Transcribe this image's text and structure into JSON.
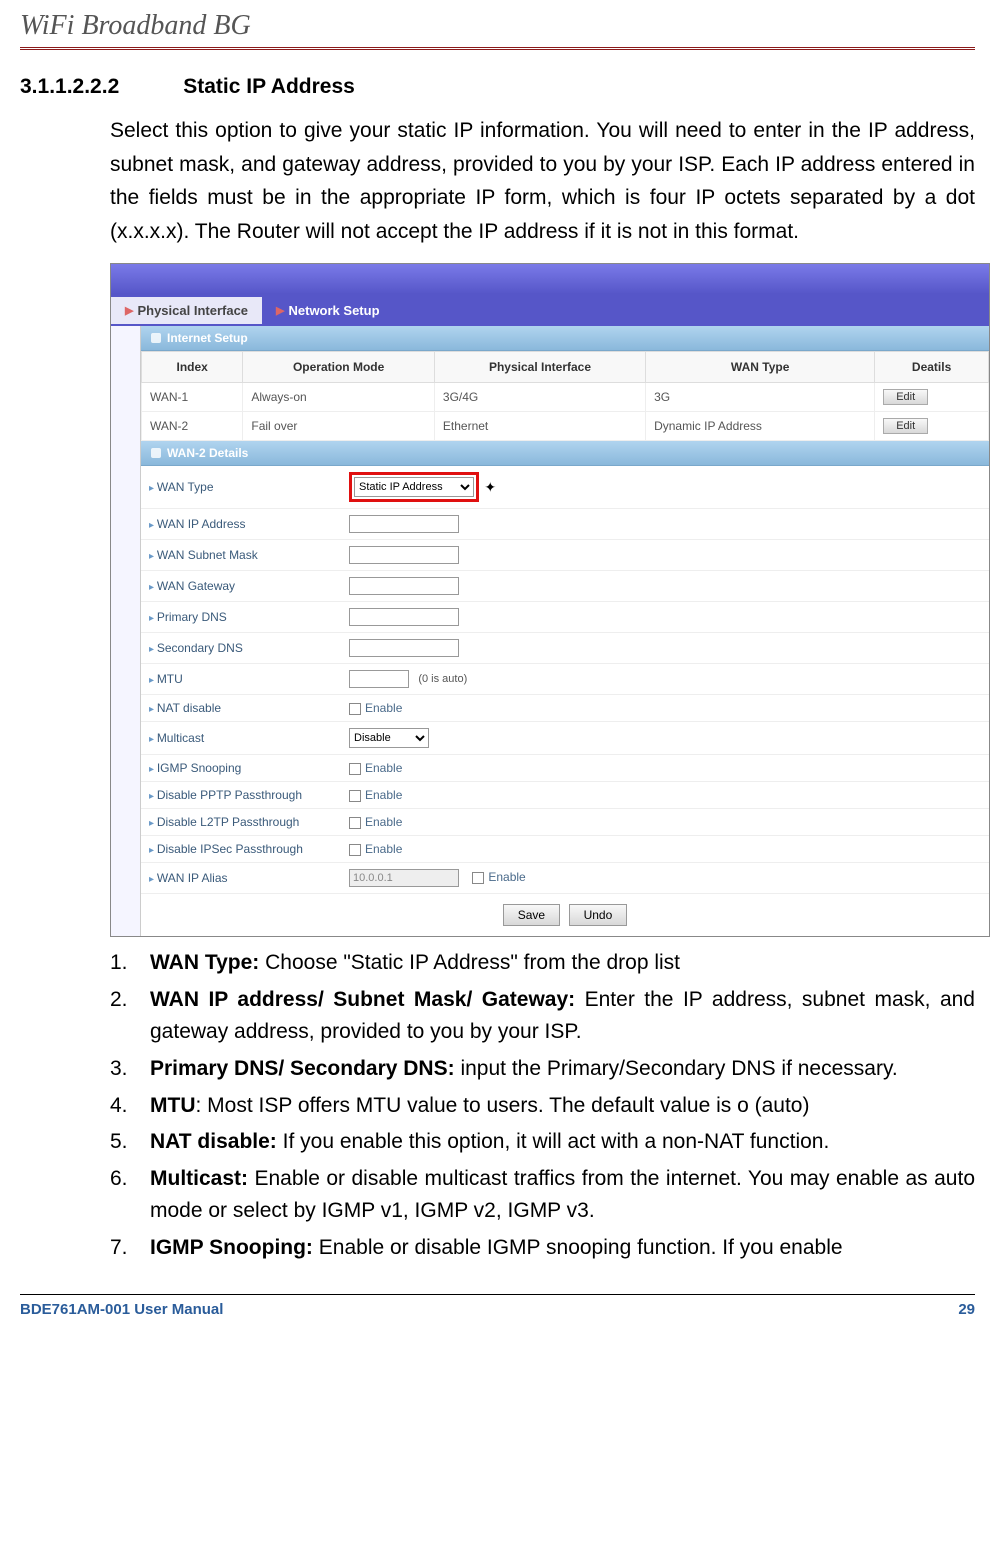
{
  "header": {
    "title": "WiFi Broadband BG"
  },
  "section": {
    "num": "3.1.1.2.2.2",
    "title": "Static IP Address"
  },
  "intro": "Select this option to give your static IP information. You will need to enter in the IP address, subnet mask, and gateway address, provided to you by your ISP. Each IP address entered in the fields must be in the appropriate IP form, which is four IP octets separated by a dot (x.x.x.x). The Router will not accept the IP address if it is not in this format.",
  "tabs": {
    "physical": "Physical Interface",
    "network": "Network Setup"
  },
  "panel": {
    "internet_setup": "Internet Setup",
    "headers": {
      "index": "Index",
      "op": "Operation Mode",
      "phy": "Physical Interface",
      "wan": "WAN Type",
      "details": "Deatils"
    },
    "rows": [
      {
        "index": "WAN-1",
        "op": "Always-on",
        "phy": "3G/4G",
        "wan": "3G",
        "btn": "Edit"
      },
      {
        "index": "WAN-2",
        "op": "Fail over",
        "phy": "Ethernet",
        "wan": "Dynamic IP Address",
        "btn": "Edit"
      }
    ],
    "details_header": "WAN-2 Details",
    "fields": {
      "wan_type": {
        "label": "WAN Type",
        "value": "Static IP Address"
      },
      "wan_ip": {
        "label": "WAN IP Address",
        "value": ""
      },
      "subnet": {
        "label": "WAN Subnet Mask",
        "value": ""
      },
      "gateway": {
        "label": "WAN Gateway",
        "value": ""
      },
      "pdns": {
        "label": "Primary DNS",
        "value": ""
      },
      "sdns": {
        "label": "Secondary DNS",
        "value": ""
      },
      "mtu": {
        "label": "MTU",
        "value": "",
        "note": "(0 is auto)"
      },
      "nat": {
        "label": "NAT disable",
        "chk": "Enable"
      },
      "multicast": {
        "label": "Multicast",
        "value": "Disable"
      },
      "igmp": {
        "label": "IGMP Snooping",
        "chk": "Enable"
      },
      "pptp": {
        "label": "Disable PPTP Passthrough",
        "chk": "Enable"
      },
      "l2tp": {
        "label": "Disable L2TP Passthrough",
        "chk": "Enable"
      },
      "ipsec": {
        "label": "Disable IPSec Passthrough",
        "chk": "Enable"
      },
      "alias": {
        "label": "WAN IP Alias",
        "value": "10.0.0.1",
        "chk": "Enable"
      }
    },
    "buttons": {
      "save": "Save",
      "undo": "Undo"
    }
  },
  "list": [
    {
      "n": "1.",
      "b": "WAN Type:",
      "t": " Choose \"Static IP Address\" from the drop list"
    },
    {
      "n": "2.",
      "b": "WAN IP address/ Subnet Mask/ Gateway:",
      "t": " Enter the IP address, subnet mask, and gateway address, provided to you by your ISP."
    },
    {
      "n": "3.",
      "b": "Primary DNS/ Secondary DNS:",
      "t": " input the Primary/Secondary DNS if necessary."
    },
    {
      "n": "4.",
      "b": "MTU",
      "t": ": Most ISP offers MTU value to users. The default value is o (auto)"
    },
    {
      "n": "5.",
      "b": "NAT disable:",
      "t": " If you enable this option, it will act with a non-NAT function."
    },
    {
      "n": "6.",
      "b": "Multicast:",
      "t": " Enable or disable multicast traffics from the internet. You may enable as auto mode or select by IGMP v1, IGMP v2, IGMP v3."
    },
    {
      "n": "7.",
      "b": "IGMP Snooping:",
      "t": " Enable or disable IGMP snooping function. If you enable"
    }
  ],
  "footer": {
    "left": "BDE761AM-001    User Manual",
    "right": "29"
  }
}
